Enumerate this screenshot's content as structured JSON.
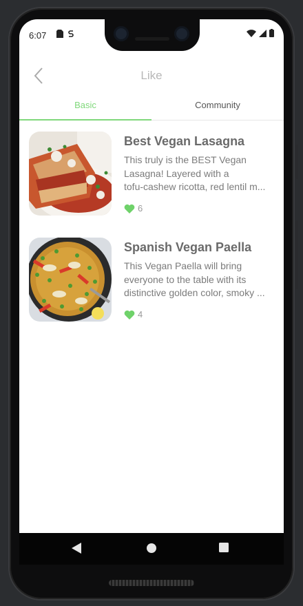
{
  "status": {
    "time": "6:07"
  },
  "header": {
    "title": "Like"
  },
  "tabs": {
    "basic": "Basic",
    "community": "Community",
    "active": "basic"
  },
  "recipes": [
    {
      "title": "Best Vegan Lasagna",
      "desc_lines": [
        "This truly is the BEST Vegan",
        "Lasagna! Layered with a",
        "tofu-cashew ricotta, red lentil m..."
      ],
      "likes": "6"
    },
    {
      "title": "Spanish Vegan Paella",
      "desc_lines": [
        "This Vegan Paella will bring",
        "everyone to the table with its",
        "distinctive golden color, smoky ..."
      ],
      "likes": "4"
    }
  ],
  "icons": {
    "back": "chevron-left-icon",
    "heart": "heart-icon",
    "nav": [
      "back-triangle-icon",
      "home-circle-icon",
      "recents-square-icon"
    ]
  },
  "colors": {
    "accent": "#7fd87a",
    "heart": "#6fd26a"
  }
}
